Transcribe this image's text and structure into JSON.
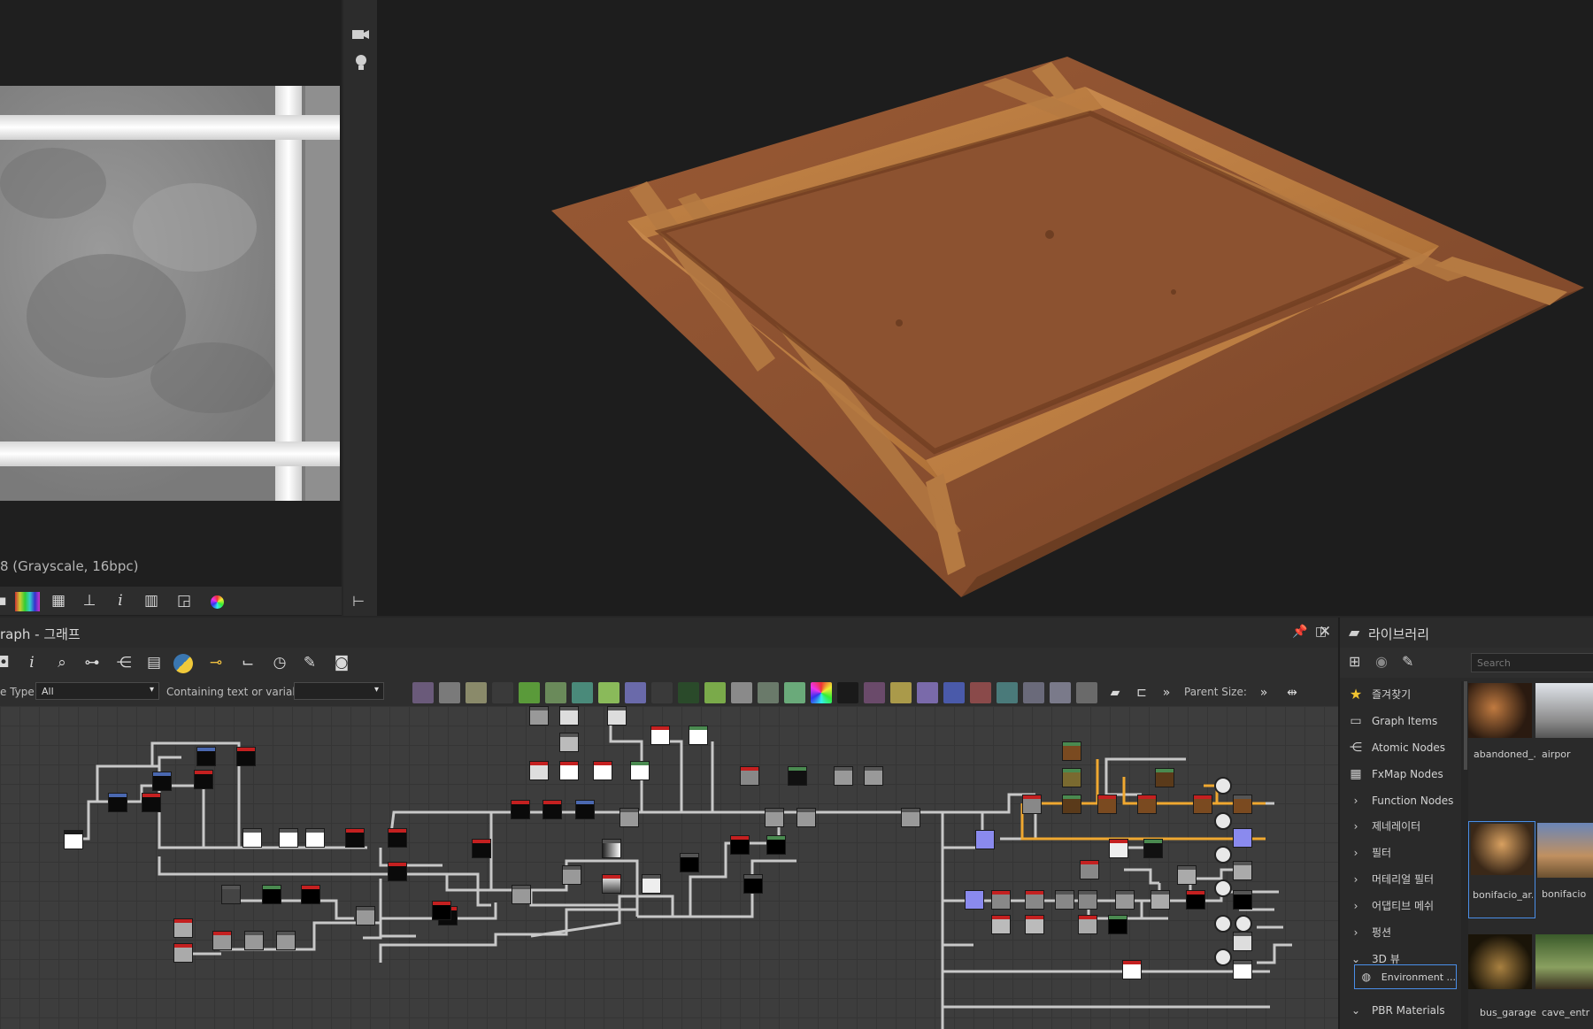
{
  "view2d": {
    "info_text": "8 (Grayscale, 16bpc)"
  },
  "view3d": {
    "camera_icon": "camera-icon",
    "light_icon": "lightbulb-icon"
  },
  "graph": {
    "title": "raph - 그래프",
    "filter_type_label": "e Type",
    "filter_type_value": "All",
    "filter_text_label": "Containing text or variable",
    "filter_text_value": "",
    "parent_size_label": "Parent Size:",
    "colors": {
      "connection": "#c8c8c8",
      "highlight": "#f0a830",
      "header_red": "#c42020",
      "header_blue": "#4a68b0",
      "header_green": "#4a8a50"
    }
  },
  "library": {
    "title": "라이브러리",
    "search_placeholder": "Search",
    "categories": [
      {
        "label": "즐겨찾기",
        "icon": "star-icon"
      },
      {
        "label": "Graph Items",
        "icon": "comment-icon"
      },
      {
        "label": "Atomic Nodes",
        "icon": "nodes-icon"
      },
      {
        "label": "FxMap Nodes",
        "icon": "grid-icon"
      },
      {
        "label": "Function Nodes",
        "icon": "chevron-right-icon"
      },
      {
        "label": "제네레이터",
        "icon": "chevron-right-icon"
      },
      {
        "label": "필터",
        "icon": "chevron-right-icon"
      },
      {
        "label": "머테리얼 필터",
        "icon": "chevron-right-icon"
      },
      {
        "label": "어댑티브 메쉬",
        "icon": "chevron-right-icon"
      },
      {
        "label": "펑션",
        "icon": "chevron-right-icon"
      },
      {
        "label": "3D 뷰",
        "icon": "chevron-down-icon"
      },
      {
        "label": "Environment ...",
        "icon": "globe-icon"
      },
      {
        "label": "PBR Materials",
        "icon": "chevron-down-icon"
      }
    ],
    "thumbnails": [
      {
        "label": "abandoned_..."
      },
      {
        "label": "airpor"
      },
      {
        "label": "bonifacio_ar..."
      },
      {
        "label": "bonifacio"
      },
      {
        "label": "bus_garage"
      },
      {
        "label": "cave_entr"
      }
    ]
  }
}
